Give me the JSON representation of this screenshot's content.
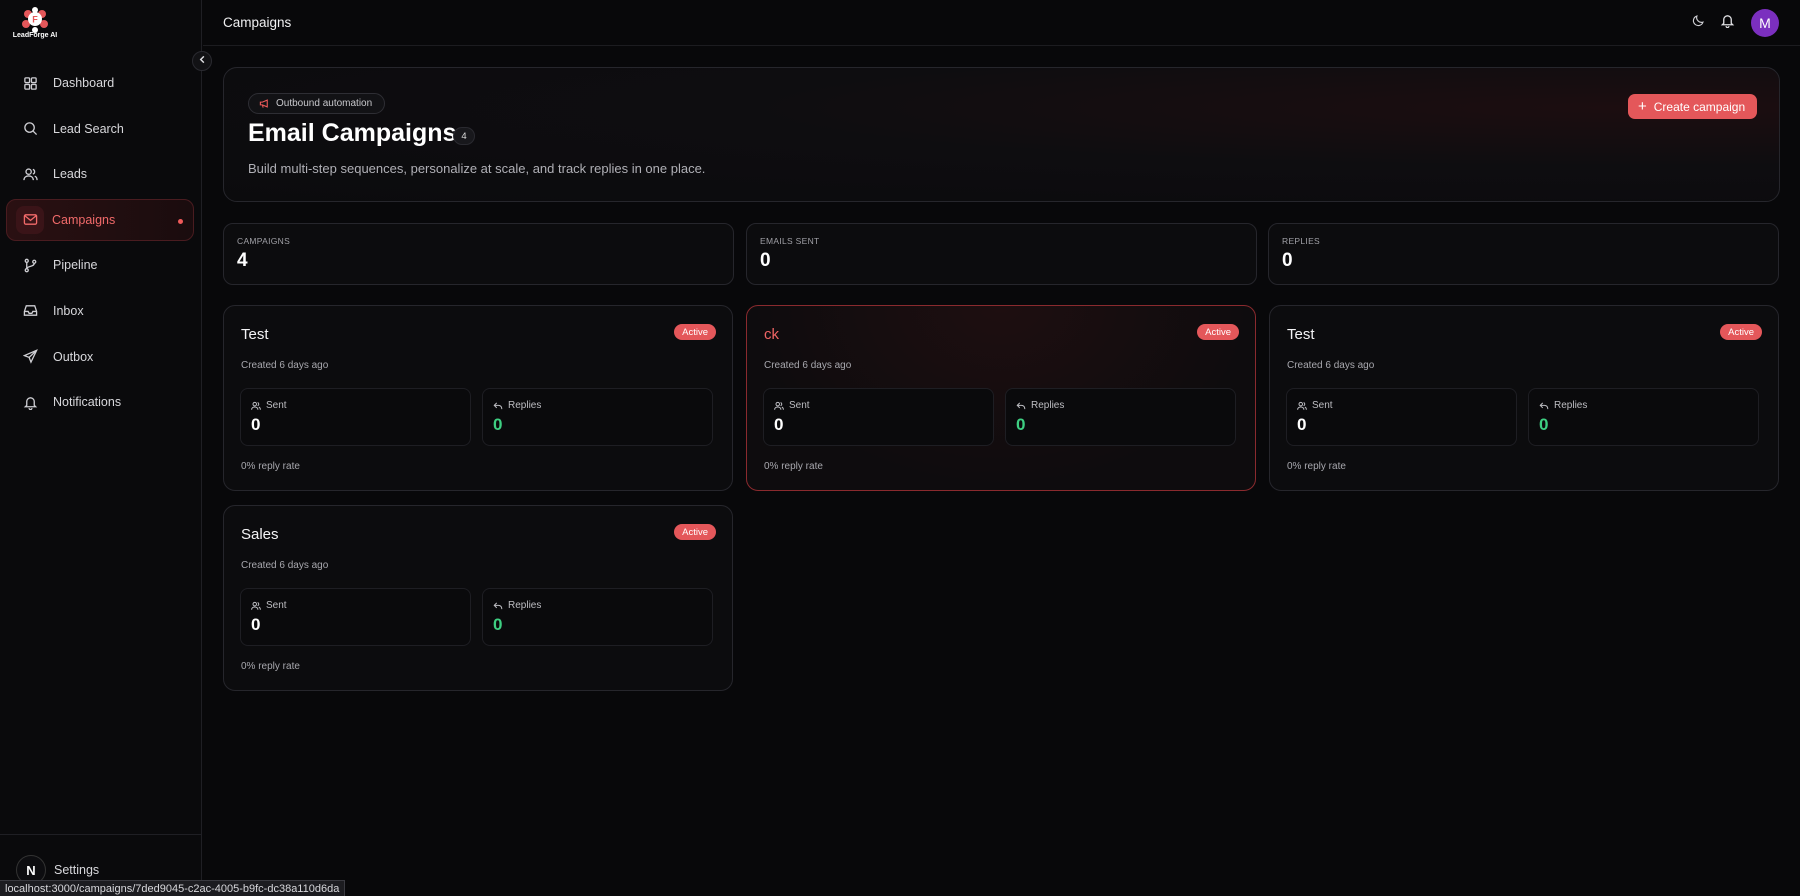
{
  "brand": {
    "logo_text": "LeadForge AI",
    "accent": "#e4575a"
  },
  "sidebar": {
    "items": [
      {
        "key": "dashboard",
        "label": "Dashboard",
        "icon": "grid-icon",
        "active": false
      },
      {
        "key": "lead-search",
        "label": "Lead Search",
        "icon": "search-icon",
        "active": false
      },
      {
        "key": "leads",
        "label": "Leads",
        "icon": "users-icon",
        "active": false
      },
      {
        "key": "campaigns",
        "label": "Campaigns",
        "icon": "mail-icon",
        "active": true
      },
      {
        "key": "pipeline",
        "label": "Pipeline",
        "icon": "branch-icon",
        "active": false
      },
      {
        "key": "inbox",
        "label": "Inbox",
        "icon": "inbox-icon",
        "active": false
      },
      {
        "key": "outbox",
        "label": "Outbox",
        "icon": "send-icon",
        "active": false
      },
      {
        "key": "notifications",
        "label": "Notifications",
        "icon": "bell-icon",
        "active": false
      }
    ],
    "footer": {
      "avatar_letter": "N",
      "label": "Settings"
    }
  },
  "header": {
    "title": "Campaigns",
    "avatar_letter": "M"
  },
  "hero": {
    "pill_label": "Outbound automation",
    "title": "Email Campaigns",
    "count": "4",
    "subtitle": "Build multi-step sequences, personalize at scale, and track replies in one place.",
    "create_label": "Create campaign"
  },
  "stats": [
    {
      "label": "CAMPAIGNS",
      "value": "4"
    },
    {
      "label": "EMAILS SENT",
      "value": "0"
    },
    {
      "label": "REPLIES",
      "value": "0"
    }
  ],
  "campaigns": [
    {
      "name": "Test",
      "status": "Active",
      "created": "Created 6 days ago",
      "sent_label": "Sent",
      "sent": "0",
      "replies_label": "Replies",
      "replies": "0",
      "reply_rate": "0% reply rate"
    },
    {
      "name": "ck",
      "status": "Active",
      "created": "Created 6 days ago",
      "sent_label": "Sent",
      "sent": "0",
      "replies_label": "Replies",
      "replies": "0",
      "reply_rate": "0% reply rate"
    },
    {
      "name": "Test",
      "status": "Active",
      "created": "Created 6 days ago",
      "sent_label": "Sent",
      "sent": "0",
      "replies_label": "Replies",
      "replies": "0",
      "reply_rate": "0% reply rate"
    },
    {
      "name": "Sales",
      "status": "Active",
      "created": "Created 6 days ago",
      "sent_label": "Sent",
      "sent": "0",
      "replies_label": "Replies",
      "replies": "0",
      "reply_rate": "0% reply rate"
    }
  ],
  "status_bar": {
    "url": "localhost:3000/campaigns/7ded9045-c2ac-4005-b9fc-dc38a110d6da"
  }
}
